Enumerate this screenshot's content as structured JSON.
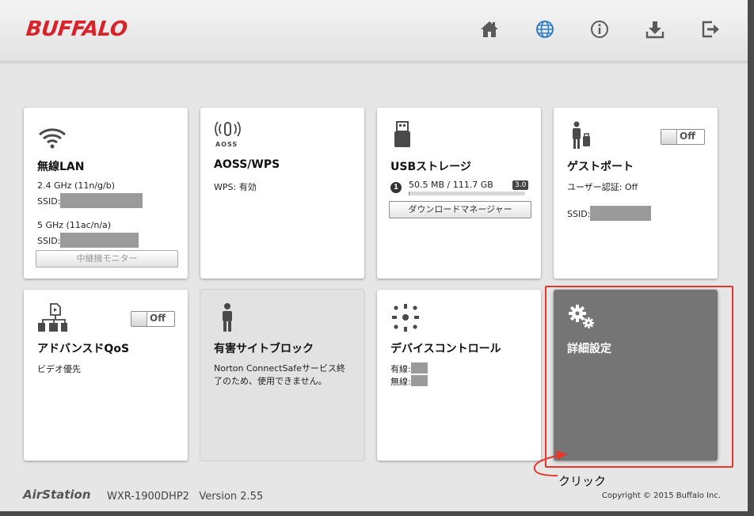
{
  "header": {
    "logo": "BUFFALO",
    "nav": [
      "home-icon",
      "globe-icon",
      "info-icon",
      "download-icon",
      "logout-icon"
    ]
  },
  "tiles": {
    "wireless_lan": {
      "title": "無線LAN",
      "band24_label": "2.4 GHz (11n/g/b)",
      "ssid_label1": "SSID:",
      "band5_label": "5 GHz (11ac/n/a)",
      "ssid_label2": "SSID:",
      "repeater_button": "中継機モニター"
    },
    "aoss": {
      "icon_caption": "AOSS",
      "title": "AOSS/WPS",
      "wps_status": "WPS: 有効"
    },
    "usb": {
      "title": "USBストレージ",
      "count": "1",
      "usage": "50.5 MB / 111.7 GB",
      "usage_fraction": 0.0005,
      "badge": "3.0",
      "download_button": "ダウンロードマネージャー"
    },
    "guest": {
      "title": "ゲストポート",
      "toggle": "Off",
      "auth": "ユーザー認証: Off",
      "ssid_label": "SSID:"
    },
    "qos": {
      "title": "アドバンスドQoS",
      "toggle": "Off",
      "mode": "ビデオ優先"
    },
    "harmful": {
      "title": "有害サイトブロック",
      "description": "Norton ConnectSafeサービス終了のため、使用できません。"
    },
    "device": {
      "title": "デバイスコントロール",
      "wired_label": "有線:",
      "wireless_label": "無線:"
    },
    "advanced": {
      "title": "詳細設定"
    }
  },
  "footer": {
    "brand": "AirStation",
    "model": "WXR-1900DHP2   Version 2.55",
    "copyright": "Copyright © 2015 Buffalo Inc."
  },
  "annotation": {
    "label": "クリック",
    "color": "#e8352a"
  }
}
